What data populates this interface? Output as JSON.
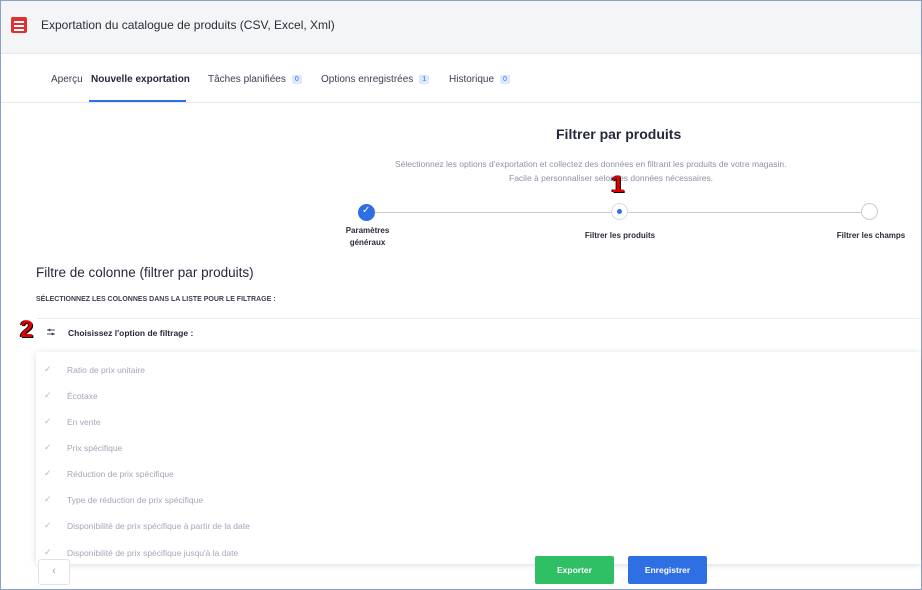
{
  "app": {
    "title": "Exportation du catalogue de produits (CSV, Excel, Xml)"
  },
  "tabs": [
    {
      "label": "Aperçu",
      "badge": null
    },
    {
      "label": "Nouvelle exportation",
      "badge": null
    },
    {
      "label": "Tâches planifiées",
      "badge": "0"
    },
    {
      "label": "Options enregistrées",
      "badge": "1"
    },
    {
      "label": "Historique",
      "badge": "0"
    }
  ],
  "main": {
    "title": "Filtrer par produits",
    "subtitle_line1": "Sélectionnez les options d'exportation et collectez des données en filtrant les produits de votre magasin.",
    "subtitle_line2": "Facile à personnaliser selon les données nécessaires."
  },
  "annotations": {
    "one": "1",
    "two": "2"
  },
  "steps": [
    {
      "label_line1": "Paramètres",
      "label_line2": "généraux",
      "state": "done"
    },
    {
      "label_line1": "Filtrer les produits",
      "label_line2": "",
      "state": "active"
    },
    {
      "label_line1": "Filtrer les champs",
      "label_line2": "",
      "state": "todo"
    }
  ],
  "section": {
    "title": "Filtre de colonne (filtrer par produits)",
    "subtitle": "SÉLECTIONNEZ LES COLONNES DANS LA LISTE POUR LE FILTRAGE :",
    "select_label": "Choisissez l'option de filtrage :"
  },
  "options": [
    "Ratio de prix unitaire",
    "Écotaxe",
    "En vente",
    "Prix spécifique",
    "Réduction de prix spécifique",
    "Type de réduction de prix spécifique",
    "Disponibilité de prix spécifique à partir de la date",
    "Disponibilité de prix spécifique jusqu'à la date"
  ],
  "footer": {
    "prev_icon": "‹",
    "export_label": "Exporter",
    "save_label": "Enregistrer"
  },
  "colors": {
    "accent": "#2f6fe4",
    "export": "#2fbf64",
    "annotation": "#e00000"
  }
}
